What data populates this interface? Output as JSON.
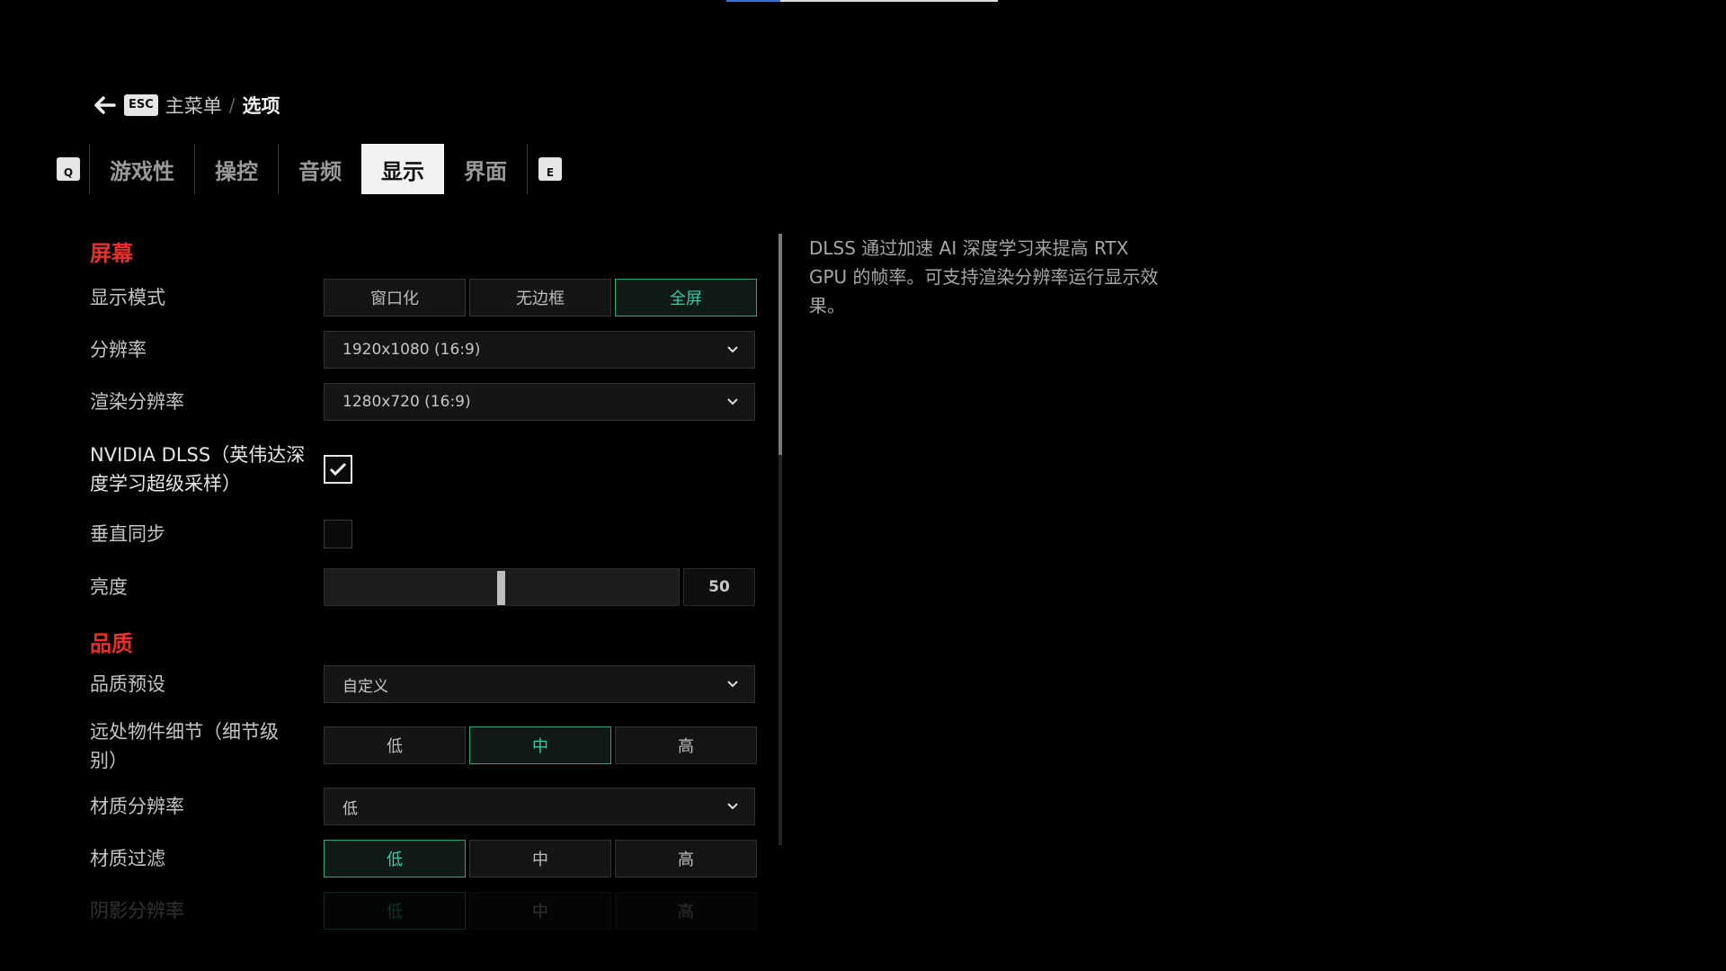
{
  "progress": {
    "fraction": 0.16
  },
  "breadcrumb": {
    "esc_key": "ESC",
    "main": "主菜单",
    "separator": "/",
    "current": "选项"
  },
  "tabs": {
    "prev_key": "Q",
    "next_key": "E",
    "items": [
      {
        "label": "游戏性"
      },
      {
        "label": "操控"
      },
      {
        "label": "音频"
      },
      {
        "label": "显示",
        "active": true
      },
      {
        "label": "界面"
      }
    ]
  },
  "screen": {
    "title": "屏幕",
    "display_mode": {
      "label": "显示模式",
      "options": [
        "窗口化",
        "无边框",
        "全屏"
      ],
      "selected": "全屏"
    },
    "resolution": {
      "label": "分辨率",
      "value": "1920x1080 (16:9)"
    },
    "render_resolution": {
      "label": "渲染分辨率",
      "value": "1280x720 (16:9)"
    },
    "dlss": {
      "label": "NVIDIA DLSS（英伟达深度学习超级采样）",
      "checked": true
    },
    "vsync": {
      "label": "垂直同步",
      "checked": false
    },
    "brightness": {
      "label": "亮度",
      "value": "50",
      "fraction": 0.5
    }
  },
  "quality": {
    "title": "品质",
    "preset": {
      "label": "品质预设",
      "value": "自定义"
    },
    "lod": {
      "label": "远处物件细节（细节级别）",
      "options": [
        "低",
        "中",
        "高"
      ],
      "selected": "中"
    },
    "texture_resolution": {
      "label": "材质分辨率",
      "value": "低"
    },
    "texture_filter": {
      "label": "材质过滤",
      "options": [
        "低",
        "中",
        "高"
      ],
      "selected": "低"
    },
    "shadow_resolution": {
      "label": "阴影分辨率",
      "options": [
        "低",
        "中",
        "高"
      ],
      "selected": "低"
    }
  },
  "description": "DLSS 通过加速 AI 深度学习来提高 RTX GPU 的帧率。可支持渲染分辨率运行显示效果。",
  "colors": {
    "accent": "#3cc9a4",
    "section": "#e3322c"
  }
}
